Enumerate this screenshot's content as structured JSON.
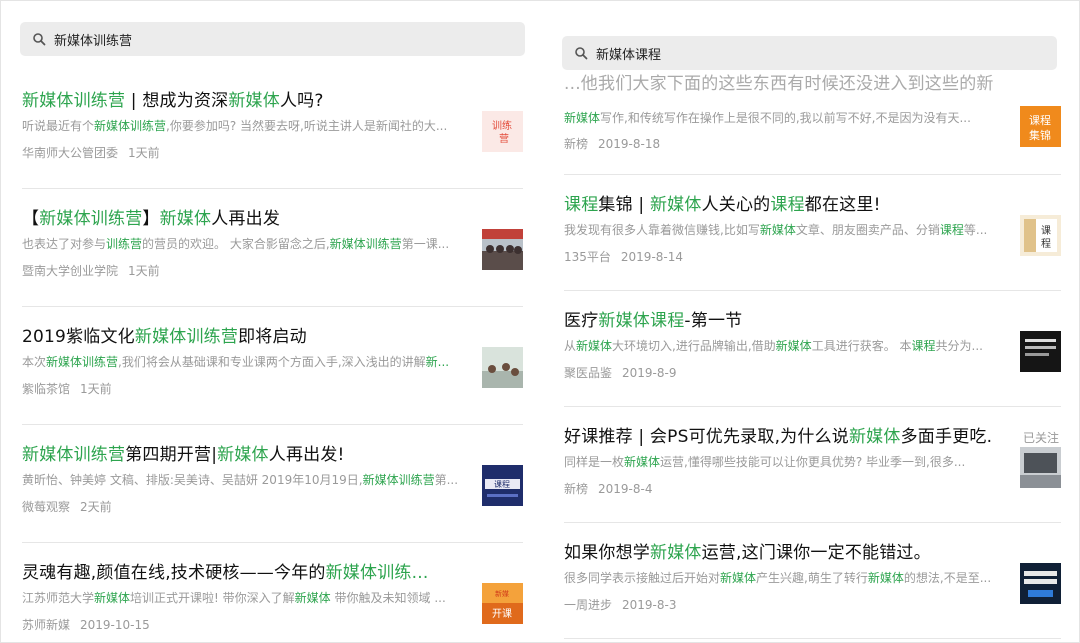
{
  "left": {
    "search_query": "新媒体训练营",
    "results": [
      {
        "title": [
          {
            "t": "新媒体训练营",
            "h": true
          },
          {
            "t": " | 想成为资深",
            "h": false
          },
          {
            "t": "新媒体",
            "h": true
          },
          {
            "t": "人吗?",
            "h": false
          }
        ],
        "desc": [
          {
            "t": "听说最近有个",
            "h": false
          },
          {
            "t": "新媒体训练营",
            "h": true
          },
          {
            "t": ",你要参加吗? 当然要去呀,听说主讲人是新闻社的大...",
            "h": false
          }
        ],
        "source": "华南师大公管团委",
        "time": "1天前",
        "thumb": "training"
      },
      {
        "title": [
          {
            "t": "【",
            "h": false
          },
          {
            "t": "新媒体训练营",
            "h": true
          },
          {
            "t": "】",
            "h": false
          },
          {
            "t": "新媒体",
            "h": true
          },
          {
            "t": "人再出发",
            "h": false
          }
        ],
        "desc": [
          {
            "t": "也表达了对参与",
            "h": false
          },
          {
            "t": "训练营",
            "h": true
          },
          {
            "t": "的营员的欢迎。 大家合影留念之后,",
            "h": false
          },
          {
            "t": "新媒体训练营",
            "h": true
          },
          {
            "t": "第一课...",
            "h": false
          }
        ],
        "source": "暨南大学创业学院",
        "time": "1天前",
        "thumb": "group"
      },
      {
        "title": [
          {
            "t": "2019紫临文化",
            "h": false
          },
          {
            "t": "新媒体训练营",
            "h": true
          },
          {
            "t": "即将启动",
            "h": false
          }
        ],
        "desc": [
          {
            "t": "本次",
            "h": false
          },
          {
            "t": "新媒体训练营",
            "h": true
          },
          {
            "t": ",我们将会从基础课和专业课两个方面入手,深入浅出的讲解",
            "h": false
          },
          {
            "t": "新...",
            "h": true
          }
        ],
        "source": "紫临茶馆",
        "time": "1天前",
        "thumb": "class"
      },
      {
        "title": [
          {
            "t": "新媒体训练营",
            "h": true
          },
          {
            "t": "第四期开营|",
            "h": false
          },
          {
            "t": "新媒体",
            "h": true
          },
          {
            "t": "人再出发!",
            "h": false
          }
        ],
        "desc": [
          {
            "t": "黄昕怡、钟美婷 文稿、排版:吴美诗、吴喆妍 2019年10月19日,",
            "h": false
          },
          {
            "t": "新媒体训练营",
            "h": true
          },
          {
            "t": "第...",
            "h": false
          }
        ],
        "source": "微莓观察",
        "time": "2天前",
        "thumb": "poster"
      },
      {
        "title": [
          {
            "t": "灵魂有趣,颜值在线,技术硬核——今年的",
            "h": false
          },
          {
            "t": "新媒体训练...",
            "h": true
          }
        ],
        "desc": [
          {
            "t": "江苏师范大学",
            "h": false
          },
          {
            "t": "新媒体",
            "h": true
          },
          {
            "t": "培训正式开课啦! 带你深入了解",
            "h": false
          },
          {
            "t": "新媒体",
            "h": true
          },
          {
            "t": " 带你触及未知领域 ...",
            "h": false
          }
        ],
        "source": "苏师新媒",
        "time": "2019-10-15",
        "thumb": "kaike"
      }
    ]
  },
  "right": {
    "search_query": "新媒体课程",
    "cut_text": "...他我们大家下面的这些东西有时候还没进入到这些的新媒体行业里做了...",
    "results": [
      {
        "title": [],
        "desc": [
          {
            "t": "新媒体",
            "h": true
          },
          {
            "t": "写作,和传统写作在操作上是很不同的,我以前写不好,不是因为没有天...",
            "h": false
          }
        ],
        "source": "新榜",
        "time": "2019-8-18",
        "thumb": "kecheng",
        "follow": ""
      },
      {
        "title": [
          {
            "t": "课程",
            "h": true
          },
          {
            "t": "集锦 | ",
            "h": false
          },
          {
            "t": "新媒体",
            "h": true
          },
          {
            "t": "人关心的",
            "h": false
          },
          {
            "t": "课程",
            "h": true
          },
          {
            "t": "都在这里!",
            "h": false
          }
        ],
        "desc": [
          {
            "t": "我发现有很多人靠着微信赚钱,比如写",
            "h": false
          },
          {
            "t": "新媒体",
            "h": true
          },
          {
            "t": "文章、朋友圈卖产品、分销",
            "h": false
          },
          {
            "t": "课程",
            "h": true
          },
          {
            "t": "等...",
            "h": false
          }
        ],
        "source": "135平台",
        "time": "2019-8-14",
        "thumb": "notebook",
        "follow": ""
      },
      {
        "title": [
          {
            "t": "医疗",
            "h": false
          },
          {
            "t": "新媒体课程",
            "h": true
          },
          {
            "t": "-第一节",
            "h": false
          }
        ],
        "desc": [
          {
            "t": "从",
            "h": false
          },
          {
            "t": "新媒体",
            "h": true
          },
          {
            "t": "大环境切入,进行品牌输出,借助",
            "h": false
          },
          {
            "t": "新媒体",
            "h": true
          },
          {
            "t": "工具进行获客。 本",
            "h": false
          },
          {
            "t": "课程",
            "h": true
          },
          {
            "t": "共分为...",
            "h": false
          }
        ],
        "source": "聚医品鉴",
        "time": "2019-8-9",
        "thumb": "dark",
        "follow": ""
      },
      {
        "title": [
          {
            "t": "好课推荐 | 会PS可优先录取,为什么说",
            "h": false
          },
          {
            "t": "新媒体",
            "h": true
          },
          {
            "t": "多面手更吃...",
            "h": false
          }
        ],
        "desc": [
          {
            "t": "同样是一枚",
            "h": false
          },
          {
            "t": "新媒体",
            "h": true
          },
          {
            "t": "运营,懂得哪些技能可以让你更具优势? 毕业季一到,很多...",
            "h": false
          }
        ],
        "source": "新榜",
        "time": "2019-8-4",
        "thumb": "desk",
        "follow": "已关注"
      },
      {
        "title": [
          {
            "t": "如果你想学",
            "h": false
          },
          {
            "t": "新媒体",
            "h": true
          },
          {
            "t": "运营,这门课你一定不能错过。",
            "h": false
          }
        ],
        "desc": [
          {
            "t": "很多同学表示接触过后开始对",
            "h": false
          },
          {
            "t": "新媒体",
            "h": true
          },
          {
            "t": "产生兴趣,萌生了转行",
            "h": false
          },
          {
            "t": "新媒体",
            "h": true
          },
          {
            "t": "的想法,不是至...",
            "h": false
          }
        ],
        "source": "一周进步",
        "time": "2019-8-3",
        "thumb": "darkblue",
        "follow": ""
      }
    ]
  },
  "colors": {
    "highlight": "#2da44e",
    "text": "#111111",
    "muted": "#9a9a9a",
    "search_bg": "#ececec"
  },
  "icons": {
    "search": "search-icon"
  }
}
